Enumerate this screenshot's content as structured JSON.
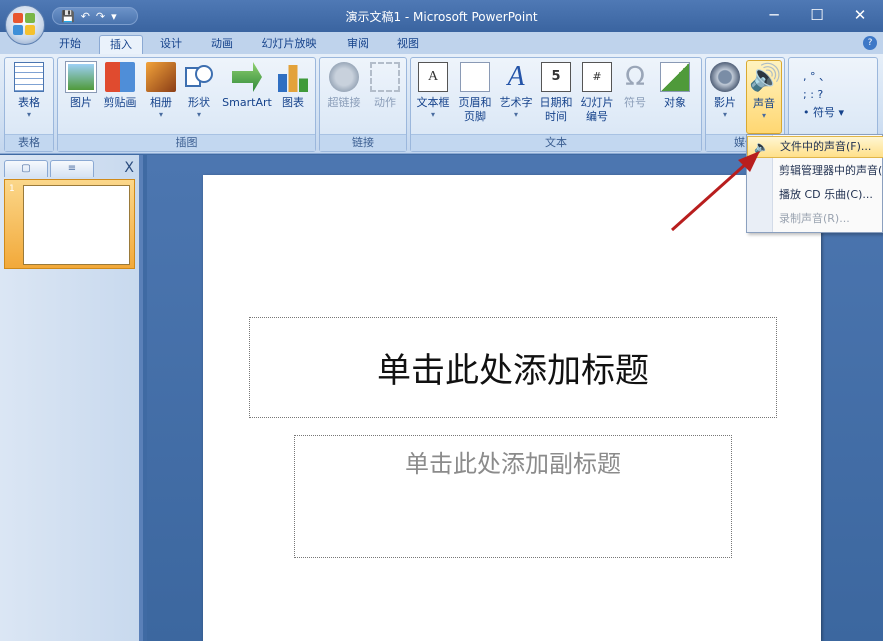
{
  "window": {
    "title": "演示文稿1 - Microsoft PowerPoint",
    "minimize": "─",
    "maximize": "☐",
    "close": "✕"
  },
  "quick_access": {
    "save": "💾",
    "undo": "↶",
    "redo": "↷",
    "customize": "▾"
  },
  "tabs": [
    "开始",
    "插入",
    "设计",
    "动画",
    "幻灯片放映",
    "审阅",
    "视图"
  ],
  "active_tab": "插入",
  "help": "?",
  "ribbon": {
    "groups": {
      "table": "表格",
      "illustrations": "插图",
      "links": "链接",
      "text": "文本",
      "media": "媒体"
    },
    "buttons": {
      "table": "表格",
      "picture": "图片",
      "clipart": "剪贴画",
      "album": "相册",
      "shapes": "形状",
      "smartart": "SmartArt",
      "chart": "图表",
      "hyperlink": "超链接",
      "action": "动作",
      "textbox": "文本框",
      "header_footer_1": "页眉和",
      "header_footer_2": "页脚",
      "wordart": "艺术字",
      "datetime_1": "日期和",
      "datetime_2": "时间",
      "slidenum_1": "幻灯片",
      "slidenum_2": "编号",
      "symbol": "符号",
      "object": "对象",
      "movie": "影片",
      "sound": "声音"
    },
    "symbols_row1": ",  °  、",
    "symbols_row2": ";  :  ?",
    "symbols_label": "• 符号 ▾"
  },
  "sound_menu": {
    "items": [
      "文件中的声音(F)...",
      "剪辑管理器中的声音(S)...",
      "播放 CD 乐曲(C)...",
      "录制声音(R)..."
    ]
  },
  "left_pane": {
    "close": "X",
    "slide_number": "1"
  },
  "slide": {
    "title_placeholder": "单击此处添加标题",
    "subtitle_placeholder": "单击此处添加副标题"
  }
}
